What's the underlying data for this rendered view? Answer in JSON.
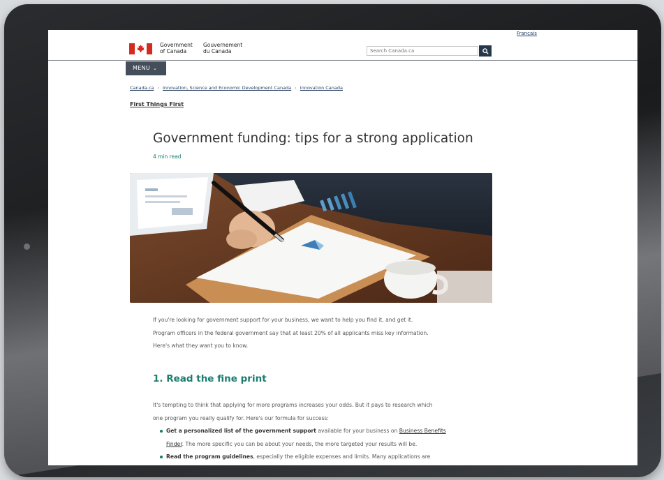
{
  "header": {
    "language_link": "Français",
    "wordmark_en": [
      "Government",
      "of Canada"
    ],
    "wordmark_fr": [
      "Gouvernement",
      "du Canada"
    ],
    "search_placeholder": "Search Canada.ca",
    "menu_label": "MENU"
  },
  "breadcrumb": [
    "Canada.ca",
    "Innovation, Science and Economic Development Canada",
    "Innovation Canada"
  ],
  "section_link": "First Things First",
  "article": {
    "title": "Government funding: tips for a strong application",
    "read_time": "4 min read",
    "intro": [
      "If you're looking for government support for your business, we want to help you find it, and get it.",
      "Program officers in the federal government say that at least 20% of all applicants miss key information.",
      "Here's what they want you to know."
    ],
    "heading_1": "1. Read the fine print",
    "para_1": [
      "It's tempting to think that applying for more programs increases your odds. But it pays to research which",
      "one program you really qualify for. Here's our formula for success:"
    ],
    "bullets": [
      {
        "bold": "Get a personalized list of the government support",
        "text_1": " available for your business on ",
        "link_a": "Business Benefits",
        "link_b": "Finder",
        "text_2": ". The more specific you can be about your needs, the more targeted your results will be."
      },
      {
        "bold": "Read the program guidelines",
        "text_1": ", especially the eligible expenses and limits. Many applications are"
      }
    ]
  },
  "colors": {
    "gc_red": "#d52b1e",
    "accent_teal": "#1a7d6e",
    "link_blue": "#284162",
    "menu_bg": "#444e5a",
    "search_button": "#26374a"
  }
}
